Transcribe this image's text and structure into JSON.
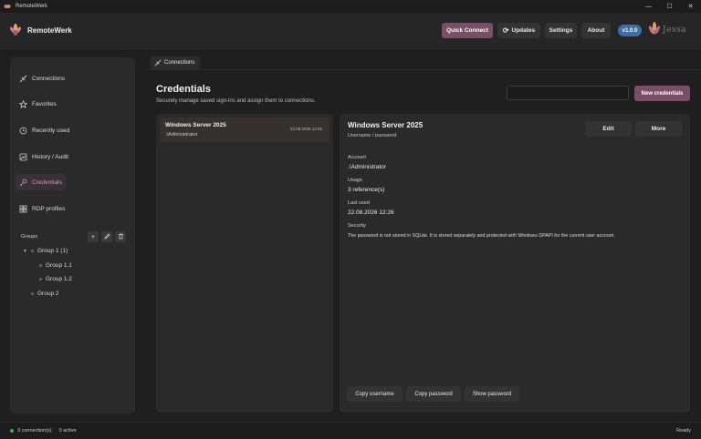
{
  "window": {
    "title": "RemoteWerk",
    "controls": [
      "—",
      "☐",
      "✕"
    ]
  },
  "header": {
    "brand": "RemoteWerk",
    "buttons": {
      "quick_connect": "Quick Connect",
      "updates": "Updates",
      "settings": "Settings",
      "about": "About"
    },
    "version": "v1.0.0",
    "partner_logo": "Jessa",
    "accent_color": "#7a4e66",
    "version_color": "#3a6fa8"
  },
  "sidebar": {
    "items": [
      {
        "label": "Connections",
        "icon": "plug-icon"
      },
      {
        "label": "Favorites",
        "icon": "star-icon"
      },
      {
        "label": "Recently used",
        "icon": "history-icon"
      },
      {
        "label": "History / Audit",
        "icon": "audit-icon"
      },
      {
        "label": "Credentials",
        "icon": "key-icon",
        "active": true
      },
      {
        "label": "RDP profiles",
        "icon": "grid-icon"
      }
    ],
    "groups_label": "Groups",
    "group_buttons": [
      "+",
      "✎",
      "🗑"
    ],
    "tree": [
      {
        "label": "Group 1 (1)",
        "expanded": true
      },
      {
        "label": "Group 1.1"
      },
      {
        "label": "Group 1.2"
      },
      {
        "label": "Group 2"
      }
    ]
  },
  "main": {
    "tab": "Connections",
    "title": "Credentials",
    "subtitle": "Securely manage saved sign-ins and assign them to connections.",
    "search_value": "",
    "new_button": "New credentials",
    "list": [
      {
        "name": "Windows Server 2025",
        "user": ".\\Administrator",
        "date": "22.08.2026 12:26"
      }
    ],
    "detail": {
      "title": "Windows Server 2025",
      "type": "Username / password",
      "edit_button": "Edit",
      "more_button": "More",
      "account_label": "Account",
      "account_value": ".\\Administrator",
      "usage_label": "Usage",
      "usage_value": "3  reference(s)",
      "last_used_label": "Last used",
      "last_used_value": "22.08.2026 12:26",
      "security_label": "Security",
      "security_value": "The password is not stored in SQLite. It is stored separately and protected with Windows DPAPI for the current user account.",
      "actions": {
        "copy_username": "Copy username",
        "copy_password": "Copy password",
        "show_password": "Show password"
      }
    }
  },
  "status": {
    "connections": "3 connection(s)",
    "active": "0 active",
    "state": "Ready",
    "dot_color": "#3fae5a"
  }
}
